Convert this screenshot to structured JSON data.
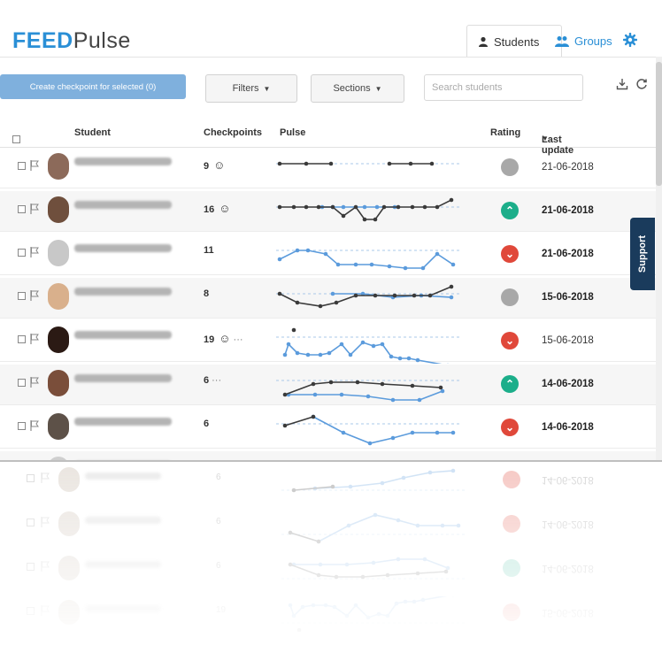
{
  "header": {
    "logo_brand": "FEED",
    "logo_product": "Pulse",
    "tabs": [
      {
        "label": "Students",
        "icon": "user-icon"
      },
      {
        "label": "Groups",
        "icon": "users-icon"
      }
    ],
    "settings_icon": "gear-icon",
    "accent_color": "#2a8fd6"
  },
  "toolbar": {
    "create_label": "Create checkpoint for selected (0)",
    "filters_label": "Filters",
    "sections_label": "Sections",
    "search_placeholder": "Search students",
    "download_icon": "download-icon",
    "refresh_icon": "refresh-icon"
  },
  "table": {
    "columns": {
      "student": "Student",
      "checkpoints": "Checkpoints",
      "pulse": "Pulse",
      "rating": "Rating",
      "last_update": "Last update"
    },
    "rows": [
      {
        "checkpoints": "9",
        "smiley": true,
        "more": false,
        "rating": "none",
        "date": "21-06-2018",
        "bold": false
      },
      {
        "checkpoints": "16",
        "smiley": true,
        "more": false,
        "rating": "up",
        "date": "21-06-2018",
        "bold": true
      },
      {
        "checkpoints": "11",
        "smiley": false,
        "more": false,
        "rating": "down",
        "date": "21-06-2018",
        "bold": true
      },
      {
        "checkpoints": "8",
        "smiley": false,
        "more": false,
        "rating": "none",
        "date": "15-06-2018",
        "bold": true
      },
      {
        "checkpoints": "19",
        "smiley": true,
        "more": true,
        "rating": "down",
        "date": "15-06-2018",
        "bold": false
      },
      {
        "checkpoints": "6",
        "smiley": false,
        "more": true,
        "rating": "up",
        "date": "14-06-2018",
        "bold": true
      },
      {
        "checkpoints": "6",
        "smiley": false,
        "more": false,
        "rating": "down",
        "date": "14-06-2018",
        "bold": true
      },
      {
        "checkpoints": "6",
        "smiley": false,
        "more": false,
        "rating": "down",
        "date": "14-06-2018",
        "bold": true
      }
    ],
    "symbols": {
      "smiley": "☺",
      "more": "···",
      "up": "⌃",
      "down": "⌄"
    }
  },
  "support_label": "Support",
  "colors": {
    "rating_none": "#a8a8a8",
    "rating_up": "#1cae8a",
    "rating_down": "#e0483a",
    "series_dark": "#3a3a3a",
    "series_blue": "#5b9bdc"
  }
}
